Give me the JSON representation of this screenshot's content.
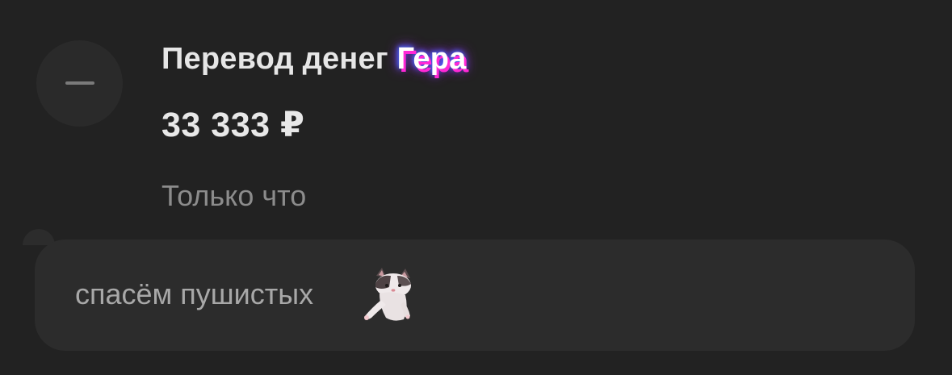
{
  "transfer": {
    "title": "Перевод денег",
    "name": "Гера",
    "amount": "33 333 ₽",
    "time": "Только что"
  },
  "message": {
    "text": "спасём пушистых",
    "sticker_icon": "cat-sticker"
  },
  "colors": {
    "background": "#222222",
    "bubble": "#2c2c2c",
    "name_glow_pink": "#ff28d6",
    "name_glow_blue": "#3f6bff"
  }
}
